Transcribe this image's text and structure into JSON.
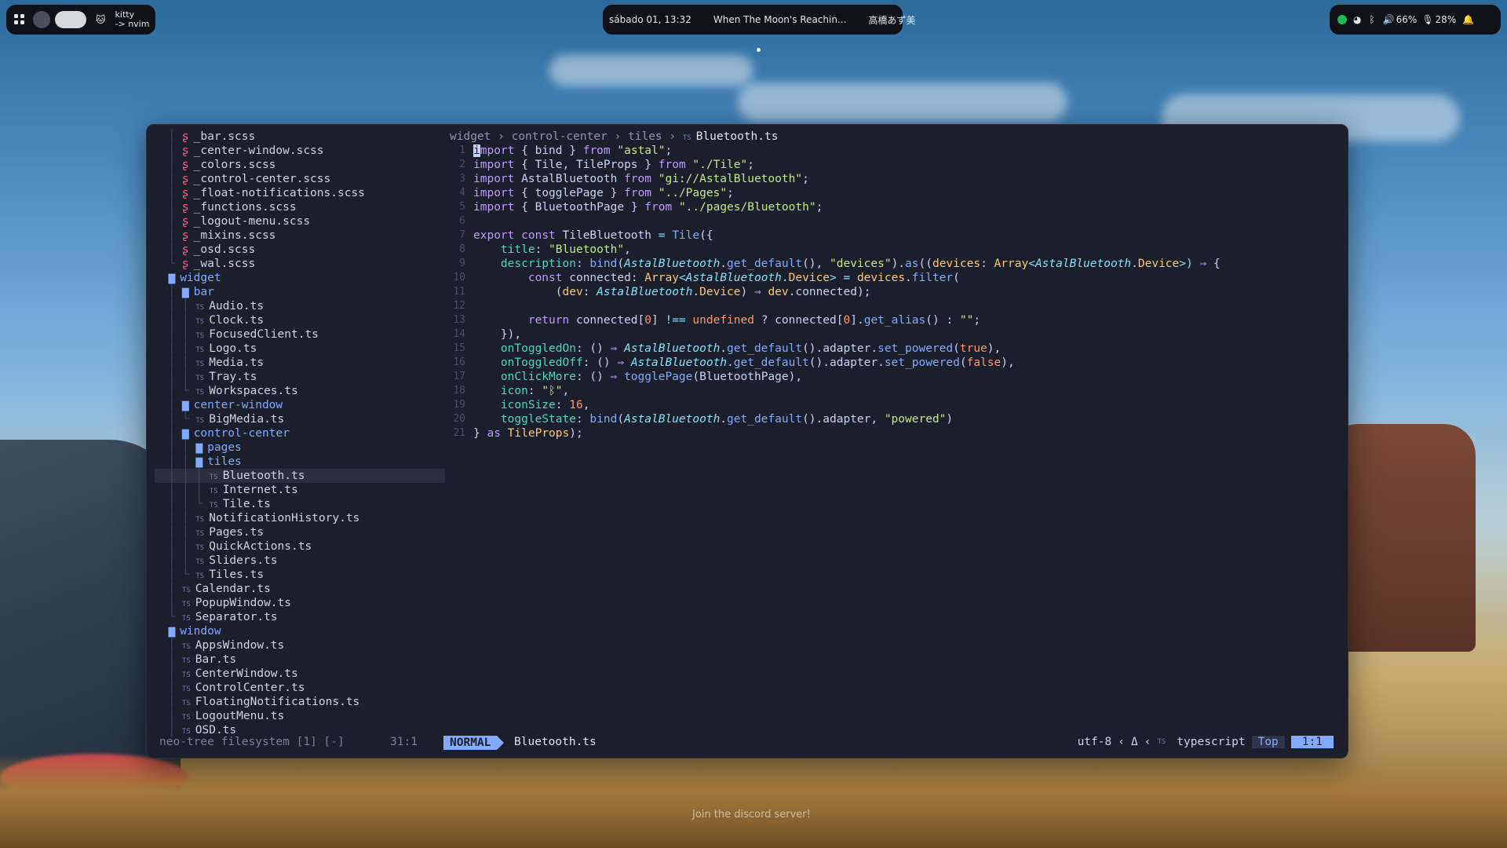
{
  "topbar": {
    "left": {
      "app": "kitty",
      "title": "-> nvim"
    },
    "center": {
      "datetime": "sábado 01, 13:32",
      "media_title": "When The Moon's Reachin...",
      "artist": "高橋あず美"
    },
    "right": {
      "volume": "66%",
      "mic": "28%"
    }
  },
  "tree": {
    "rows": [
      {
        "indent": "  │ ",
        "icon": "scss",
        "label": "_bar.scss",
        "type": "file"
      },
      {
        "indent": "  │ ",
        "icon": "scss",
        "label": "_center-window.scss",
        "type": "file"
      },
      {
        "indent": "  │ ",
        "icon": "scss",
        "label": "_colors.scss",
        "type": "file"
      },
      {
        "indent": "  │ ",
        "icon": "scss",
        "label": "_control-center.scss",
        "type": "file"
      },
      {
        "indent": "  │ ",
        "icon": "scss",
        "label": "_float-notifications.scss",
        "type": "file"
      },
      {
        "indent": "  │ ",
        "icon": "scss",
        "label": "_functions.scss",
        "type": "file"
      },
      {
        "indent": "  │ ",
        "icon": "scss",
        "label": "_logout-menu.scss",
        "type": "file"
      },
      {
        "indent": "  │ ",
        "icon": "scss",
        "label": "_mixins.scss",
        "type": "file"
      },
      {
        "indent": "  │ ",
        "icon": "scss",
        "label": "_osd.scss",
        "type": "file"
      },
      {
        "indent": "  └ ",
        "icon": "scss",
        "label": "_wal.scss",
        "type": "file"
      },
      {
        "indent": "  ",
        "icon": "folder",
        "label": "widget",
        "type": "dir"
      },
      {
        "indent": "  │ ",
        "icon": "folder",
        "label": "bar",
        "type": "dir"
      },
      {
        "indent": "  │ │ ",
        "icon": "ts",
        "label": "Audio.ts",
        "type": "file"
      },
      {
        "indent": "  │ │ ",
        "icon": "ts",
        "label": "Clock.ts",
        "type": "file"
      },
      {
        "indent": "  │ │ ",
        "icon": "ts",
        "label": "FocusedClient.ts",
        "type": "file"
      },
      {
        "indent": "  │ │ ",
        "icon": "ts",
        "label": "Logo.ts",
        "type": "file"
      },
      {
        "indent": "  │ │ ",
        "icon": "ts",
        "label": "Media.ts",
        "type": "file"
      },
      {
        "indent": "  │ │ ",
        "icon": "ts",
        "label": "Tray.ts",
        "type": "file"
      },
      {
        "indent": "  │ └ ",
        "icon": "ts",
        "label": "Workspaces.ts",
        "type": "file"
      },
      {
        "indent": "  │ ",
        "icon": "folder",
        "label": "center-window",
        "type": "dir"
      },
      {
        "indent": "  │ └ ",
        "icon": "ts",
        "label": "BigMedia.ts",
        "type": "file"
      },
      {
        "indent": "  │ ",
        "icon": "folder",
        "label": "control-center",
        "type": "dir"
      },
      {
        "indent": "  │ │ ",
        "icon": "folder",
        "label": "pages",
        "type": "dir"
      },
      {
        "indent": "  │ │ ",
        "icon": "folder",
        "label": "tiles",
        "type": "dir"
      },
      {
        "indent": "  │ │ │ ",
        "icon": "ts",
        "label": "Bluetooth.ts",
        "type": "file",
        "selected": true
      },
      {
        "indent": "  │ │ │ ",
        "icon": "ts",
        "label": "Internet.ts",
        "type": "file"
      },
      {
        "indent": "  │ │ └ ",
        "icon": "ts",
        "label": "Tile.ts",
        "type": "file"
      },
      {
        "indent": "  │ │ ",
        "icon": "ts",
        "label": "NotificationHistory.ts",
        "type": "file"
      },
      {
        "indent": "  │ │ ",
        "icon": "ts",
        "label": "Pages.ts",
        "type": "file"
      },
      {
        "indent": "  │ │ ",
        "icon": "ts",
        "label": "QuickActions.ts",
        "type": "file"
      },
      {
        "indent": "  │ │ ",
        "icon": "ts",
        "label": "Sliders.ts",
        "type": "file"
      },
      {
        "indent": "  │ └ ",
        "icon": "ts",
        "label": "Tiles.ts",
        "type": "file"
      },
      {
        "indent": "  │ ",
        "icon": "ts",
        "label": "Calendar.ts",
        "type": "file"
      },
      {
        "indent": "  │ ",
        "icon": "ts",
        "label": "PopupWindow.ts",
        "type": "file"
      },
      {
        "indent": "  └ ",
        "icon": "ts",
        "label": "Separator.ts",
        "type": "file"
      },
      {
        "indent": "  ",
        "icon": "folder",
        "label": "window",
        "type": "dir"
      },
      {
        "indent": "  │ ",
        "icon": "ts",
        "label": "AppsWindow.ts",
        "type": "file"
      },
      {
        "indent": "  │ ",
        "icon": "ts",
        "label": "Bar.ts",
        "type": "file"
      },
      {
        "indent": "  │ ",
        "icon": "ts",
        "label": "CenterWindow.ts",
        "type": "file"
      },
      {
        "indent": "  │ ",
        "icon": "ts",
        "label": "ControlCenter.ts",
        "type": "file"
      },
      {
        "indent": "  │ ",
        "icon": "ts",
        "label": "FloatingNotifications.ts",
        "type": "file"
      },
      {
        "indent": "  │ ",
        "icon": "ts",
        "label": "LogoutMenu.ts",
        "type": "file"
      },
      {
        "indent": "  │ ",
        "icon": "ts",
        "label": "OSD.ts",
        "type": "file"
      }
    ]
  },
  "breadcrumb": {
    "parts": [
      "widget",
      "control-center",
      "tiles"
    ],
    "current": "Bluetooth.ts"
  },
  "code": {
    "lines": [
      [
        {
          "t": "import",
          "c": "kw"
        },
        {
          "t": " { ",
          "c": "pun"
        },
        {
          "t": "bind",
          "c": "code"
        },
        {
          "t": " } ",
          "c": "pun"
        },
        {
          "t": "from",
          "c": "kw"
        },
        {
          "t": " ",
          "c": "pun"
        },
        {
          "t": "\"astal\"",
          "c": "str"
        },
        {
          "t": ";",
          "c": "pun"
        }
      ],
      [
        {
          "t": "import",
          "c": "kw"
        },
        {
          "t": " { ",
          "c": "pun"
        },
        {
          "t": "Tile, TileProps",
          "c": "code"
        },
        {
          "t": " } ",
          "c": "pun"
        },
        {
          "t": "from",
          "c": "kw"
        },
        {
          "t": " ",
          "c": "pun"
        },
        {
          "t": "\"./Tile\"",
          "c": "str"
        },
        {
          "t": ";",
          "c": "pun"
        }
      ],
      [
        {
          "t": "import",
          "c": "kw"
        },
        {
          "t": " AstalBluetooth ",
          "c": "code"
        },
        {
          "t": "from",
          "c": "kw"
        },
        {
          "t": " ",
          "c": "pun"
        },
        {
          "t": "\"gi://AstalBluetooth\"",
          "c": "str"
        },
        {
          "t": ";",
          "c": "pun"
        }
      ],
      [
        {
          "t": "import",
          "c": "kw"
        },
        {
          "t": " { ",
          "c": "pun"
        },
        {
          "t": "togglePage",
          "c": "code"
        },
        {
          "t": " } ",
          "c": "pun"
        },
        {
          "t": "from",
          "c": "kw"
        },
        {
          "t": " ",
          "c": "pun"
        },
        {
          "t": "\"../Pages\"",
          "c": "str"
        },
        {
          "t": ";",
          "c": "pun"
        }
      ],
      [
        {
          "t": "import",
          "c": "kw"
        },
        {
          "t": " { ",
          "c": "pun"
        },
        {
          "t": "BluetoothPage",
          "c": "code"
        },
        {
          "t": " } ",
          "c": "pun"
        },
        {
          "t": "from",
          "c": "kw"
        },
        {
          "t": " ",
          "c": "pun"
        },
        {
          "t": "\"../pages/Bluetooth\"",
          "c": "str"
        },
        {
          "t": ";",
          "c": "pun"
        }
      ],
      [],
      [
        {
          "t": "export",
          "c": "kw"
        },
        {
          "t": " ",
          "c": "pun"
        },
        {
          "t": "const",
          "c": "kw"
        },
        {
          "t": " TileBluetooth ",
          "c": "code"
        },
        {
          "t": "=",
          "c": "op"
        },
        {
          "t": " ",
          "c": "pun"
        },
        {
          "t": "Tile",
          "c": "fn"
        },
        {
          "t": "({",
          "c": "pun"
        }
      ],
      [
        {
          "t": "    ",
          "c": "pun"
        },
        {
          "t": "title",
          "c": "prop"
        },
        {
          "t": ": ",
          "c": "pun"
        },
        {
          "t": "\"Bluetooth\"",
          "c": "str"
        },
        {
          "t": ",",
          "c": "pun"
        }
      ],
      [
        {
          "t": "    ",
          "c": "pun"
        },
        {
          "t": "description",
          "c": "prop"
        },
        {
          "t": ": ",
          "c": "pun"
        },
        {
          "t": "bind",
          "c": "fn"
        },
        {
          "t": "(",
          "c": "pun"
        },
        {
          "t": "AstalBluetooth",
          "c": "it"
        },
        {
          "t": ".",
          "c": "pun"
        },
        {
          "t": "get_default",
          "c": "fn"
        },
        {
          "t": "(), ",
          "c": "pun"
        },
        {
          "t": "\"devices\"",
          "c": "str"
        },
        {
          "t": ").",
          "c": "pun"
        },
        {
          "t": "as",
          "c": "fn"
        },
        {
          "t": "((",
          "c": "pun"
        },
        {
          "t": "devices",
          "c": "ty"
        },
        {
          "t": ": ",
          "c": "pun"
        },
        {
          "t": "Array",
          "c": "ty"
        },
        {
          "t": "<",
          "c": "op"
        },
        {
          "t": "AstalBluetooth",
          "c": "it"
        },
        {
          "t": ".",
          "c": "pun"
        },
        {
          "t": "Device",
          "c": "ty"
        },
        {
          "t": ">) ",
          "c": "op"
        },
        {
          "t": "⇒",
          "c": "kw"
        },
        {
          "t": " {",
          "c": "pun"
        }
      ],
      [
        {
          "t": "        ",
          "c": "pun"
        },
        {
          "t": "const",
          "c": "kw"
        },
        {
          "t": " connected",
          "c": "code"
        },
        {
          "t": ": ",
          "c": "pun"
        },
        {
          "t": "Array",
          "c": "ty"
        },
        {
          "t": "<",
          "c": "op"
        },
        {
          "t": "AstalBluetooth",
          "c": "it"
        },
        {
          "t": ".",
          "c": "pun"
        },
        {
          "t": "Device",
          "c": "ty"
        },
        {
          "t": "> = ",
          "c": "op"
        },
        {
          "t": "devices",
          "c": "ty"
        },
        {
          "t": ".",
          "c": "pun"
        },
        {
          "t": "filter",
          "c": "fn"
        },
        {
          "t": "(",
          "c": "pun"
        }
      ],
      [
        {
          "t": "            (",
          "c": "pun"
        },
        {
          "t": "dev",
          "c": "ty"
        },
        {
          "t": ": ",
          "c": "pun"
        },
        {
          "t": "AstalBluetooth",
          "c": "it"
        },
        {
          "t": ".",
          "c": "pun"
        },
        {
          "t": "Device",
          "c": "ty"
        },
        {
          "t": ") ",
          "c": "pun"
        },
        {
          "t": "⇒",
          "c": "kw"
        },
        {
          "t": " ",
          "c": "pun"
        },
        {
          "t": "dev",
          "c": "ty"
        },
        {
          "t": ".",
          "c": "pun"
        },
        {
          "t": "connected",
          "c": "code"
        },
        {
          "t": ");",
          "c": "pun"
        }
      ],
      [],
      [
        {
          "t": "        ",
          "c": "pun"
        },
        {
          "t": "return",
          "c": "kw"
        },
        {
          "t": " connected[",
          "c": "code"
        },
        {
          "t": "0",
          "c": "num"
        },
        {
          "t": "] ",
          "c": "code"
        },
        {
          "t": "!==",
          "c": "op"
        },
        {
          "t": " ",
          "c": "pun"
        },
        {
          "t": "undefined",
          "c": "num"
        },
        {
          "t": " ? connected[",
          "c": "code"
        },
        {
          "t": "0",
          "c": "num"
        },
        {
          "t": "].",
          "c": "code"
        },
        {
          "t": "get_alias",
          "c": "fn"
        },
        {
          "t": "() : ",
          "c": "pun"
        },
        {
          "t": "\"\"",
          "c": "str"
        },
        {
          "t": ";",
          "c": "pun"
        }
      ],
      [
        {
          "t": "    }),",
          "c": "pun"
        }
      ],
      [
        {
          "t": "    ",
          "c": "pun"
        },
        {
          "t": "onToggledOn",
          "c": "prop"
        },
        {
          "t": ": () ",
          "c": "pun"
        },
        {
          "t": "⇒",
          "c": "kw"
        },
        {
          "t": " ",
          "c": "pun"
        },
        {
          "t": "AstalBluetooth",
          "c": "it"
        },
        {
          "t": ".",
          "c": "pun"
        },
        {
          "t": "get_default",
          "c": "fn"
        },
        {
          "t": "().adapter.",
          "c": "pun"
        },
        {
          "t": "set_powered",
          "c": "fn"
        },
        {
          "t": "(",
          "c": "pun"
        },
        {
          "t": "true",
          "c": "num"
        },
        {
          "t": "),",
          "c": "pun"
        }
      ],
      [
        {
          "t": "    ",
          "c": "pun"
        },
        {
          "t": "onToggledOff",
          "c": "prop"
        },
        {
          "t": ": () ",
          "c": "pun"
        },
        {
          "t": "⇒",
          "c": "kw"
        },
        {
          "t": " ",
          "c": "pun"
        },
        {
          "t": "AstalBluetooth",
          "c": "it"
        },
        {
          "t": ".",
          "c": "pun"
        },
        {
          "t": "get_default",
          "c": "fn"
        },
        {
          "t": "().adapter.",
          "c": "pun"
        },
        {
          "t": "set_powered",
          "c": "fn"
        },
        {
          "t": "(",
          "c": "pun"
        },
        {
          "t": "false",
          "c": "num"
        },
        {
          "t": "),",
          "c": "pun"
        }
      ],
      [
        {
          "t": "    ",
          "c": "pun"
        },
        {
          "t": "onClickMore",
          "c": "prop"
        },
        {
          "t": ": () ",
          "c": "pun"
        },
        {
          "t": "⇒",
          "c": "kw"
        },
        {
          "t": " ",
          "c": "pun"
        },
        {
          "t": "togglePage",
          "c": "fn"
        },
        {
          "t": "(BluetoothPage),",
          "c": "pun"
        }
      ],
      [
        {
          "t": "    ",
          "c": "pun"
        },
        {
          "t": "icon",
          "c": "prop"
        },
        {
          "t": ": ",
          "c": "pun"
        },
        {
          "t": "\"ᛒ\"",
          "c": "str"
        },
        {
          "t": ",",
          "c": "pun"
        }
      ],
      [
        {
          "t": "    ",
          "c": "pun"
        },
        {
          "t": "iconSize",
          "c": "prop"
        },
        {
          "t": ": ",
          "c": "pun"
        },
        {
          "t": "16",
          "c": "num"
        },
        {
          "t": ",",
          "c": "pun"
        }
      ],
      [
        {
          "t": "    ",
          "c": "pun"
        },
        {
          "t": "toggleState",
          "c": "prop"
        },
        {
          "t": ": ",
          "c": "pun"
        },
        {
          "t": "bind",
          "c": "fn"
        },
        {
          "t": "(",
          "c": "pun"
        },
        {
          "t": "AstalBluetooth",
          "c": "it"
        },
        {
          "t": ".",
          "c": "pun"
        },
        {
          "t": "get_default",
          "c": "fn"
        },
        {
          "t": "().adapter, ",
          "c": "pun"
        },
        {
          "t": "\"powered\"",
          "c": "str"
        },
        {
          "t": ")",
          "c": "pun"
        }
      ],
      [
        {
          "t": "} ",
          "c": "pun"
        },
        {
          "t": "as",
          "c": "kw"
        },
        {
          "t": " ",
          "c": "pun"
        },
        {
          "t": "TileProps",
          "c": "ty"
        },
        {
          "t": ");",
          "c": "pun"
        }
      ]
    ]
  },
  "statusline": {
    "tree_label": "neo-tree filesystem [1] [-]",
    "tree_pos": "31:1",
    "mode": "NORMAL",
    "file": "Bluetooth.ts",
    "encoding": "utf-8",
    "delta": "Δ",
    "filetype": "typescript",
    "scroll": "Top",
    "position": "1:1"
  },
  "footer": {
    "text": "Join the discord server!"
  }
}
